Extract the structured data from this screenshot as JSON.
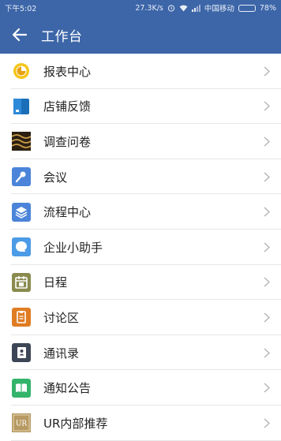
{
  "status_bar": {
    "time": "下午5:02",
    "net_speed": "27.3K/s",
    "carrier": "中国移动",
    "battery_text": "78%",
    "battery_level": 0.78
  },
  "app_bar": {
    "title": "工作台",
    "back_icon": "arrow-left-icon"
  },
  "items": [
    {
      "label": "报表中心",
      "icon": "report-icon",
      "color": "#f1c232"
    },
    {
      "label": "店铺反馈",
      "icon": "store-feedback-icon",
      "color": "#1f7fc9"
    },
    {
      "label": "调查问卷",
      "icon": "survey-icon",
      "color": "#3a2c17"
    },
    {
      "label": "会议",
      "icon": "meeting-microphone-icon",
      "color": "#4b84d9"
    },
    {
      "label": "流程中心",
      "icon": "layers-icon",
      "color": "#4b84d9"
    },
    {
      "label": "企业小助手",
      "icon": "chat-bubble-icon",
      "color": "#4b9be6"
    },
    {
      "label": "日程",
      "icon": "calendar-icon",
      "color": "#8a8a4f"
    },
    {
      "label": "讨论区",
      "icon": "clipboard-icon",
      "color": "#e07c22"
    },
    {
      "label": "通讯录",
      "icon": "contacts-icon",
      "color": "#3d4657"
    },
    {
      "label": "通知公告",
      "icon": "book-icon",
      "color": "#33b46a"
    },
    {
      "label": "UR内部推荐",
      "icon": "ur-logo-icon",
      "color": "#b79a63"
    }
  ]
}
